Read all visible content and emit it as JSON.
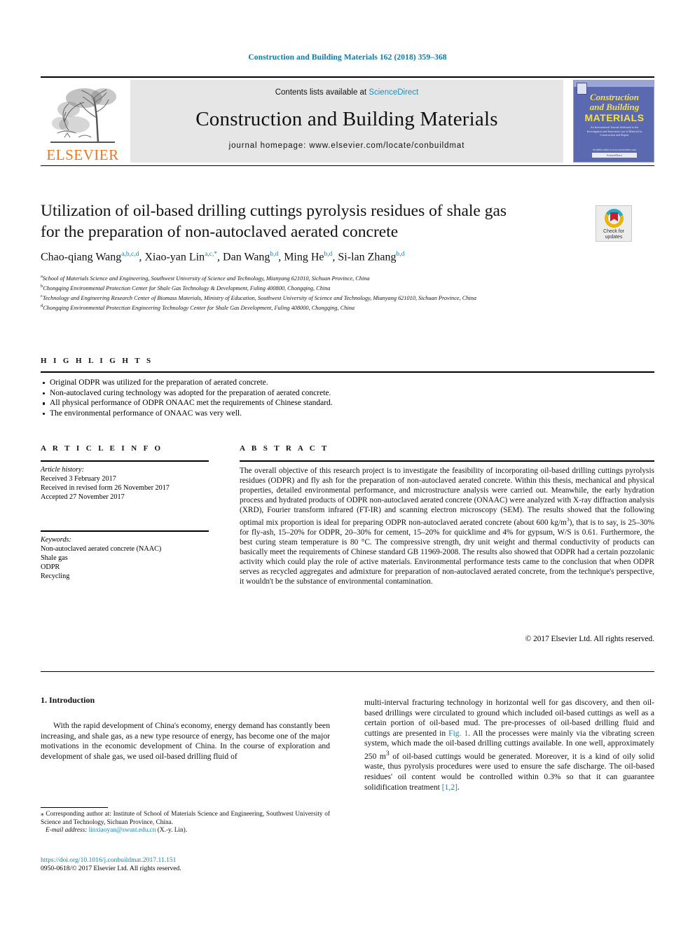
{
  "running_head": "Construction and Building Materials 162 (2018) 359–368",
  "masthead": {
    "publisher_name": "ELSEVIER",
    "contents_prefix": "Contents lists available at ",
    "contents_link": "ScienceDirect",
    "journal_title": "Construction and Building Materials",
    "homepage_label": "journal homepage: www.elsevier.com/locate/conbuildmat",
    "cover": {
      "line1": "Construction",
      "line2": "and Building",
      "line3": "MATERIALS",
      "blurb": "An International Journal dedicated to the Investigation and Innovative use of Material in Construction and Repair",
      "footer": "Available online at www.sciencedirect.com",
      "footer_box": "ScienceDirect"
    }
  },
  "article": {
    "title_line1": "Utilization of oil-based drilling cuttings pyrolysis residues of shale gas",
    "title_line2": "for the preparation of non-autoclaved aerated concrete",
    "crossmark": {
      "line1": "Check for",
      "line2": "updates"
    },
    "authors": [
      {
        "name": "Chao-qiang Wang",
        "sup": "a,b,c,d"
      },
      {
        "name": "Xiao-yan Lin",
        "sup": "a,c,*"
      },
      {
        "name": "Dan Wang",
        "sup": "b,d"
      },
      {
        "name": "Ming He",
        "sup": "b,d"
      },
      {
        "name": "Si-lan Zhang",
        "sup": "b,d"
      }
    ],
    "affiliations": [
      {
        "marker": "a",
        "text": "School of Materials Science and Engineering, Southwest University of Science and Technology, Mianyang 621010, Sichuan Province, China"
      },
      {
        "marker": "b",
        "text": "Chongqing Environmental Protection Center for Shale Gas Technology & Development, Fuling 400800, Chongqing, China"
      },
      {
        "marker": "c",
        "text": "Technology and Engineering Research Center of Biomass Materials, Ministry of Education, Southwest University of Science and Technology, Mianyang 621010, Sichuan Province, China"
      },
      {
        "marker": "d",
        "text": "Chongqing Environmental Protection Engineering Technology Center for Shale Gas Development, Fuling 408000, Chongqing, China"
      }
    ]
  },
  "highlights": {
    "label": "H I G H L I G H T S",
    "items": [
      "Original ODPR was utilized for the preparation of aerated concrete.",
      "Non-autoclaved curing technology was adopted for the preparation of aerated concrete.",
      "All physical performance of ODPR ONAAC met the requirements of Chinese standard.",
      "The environmental performance of ONAAC was very well."
    ]
  },
  "article_info": {
    "label": "A R T I C L E   I N F O",
    "history_label": "Article history:",
    "history": [
      "Received 3 February 2017",
      "Received in revised form 26 November 2017",
      "Accepted 27 November 2017"
    ],
    "keywords_label": "Keywords:",
    "keywords": [
      "Non-autoclaved aerated concrete (NAAC)",
      "Shale gas",
      "ODPR",
      "Recycling"
    ]
  },
  "abstract": {
    "label": "A B S T R A C T",
    "text_part1": "The overall objective of this research project is to investigate the feasibility of incorporating oil-based drilling cuttings pyrolysis residues (ODPR) and fly ash for the preparation of non-autoclaved aerated concrete. Within this thesis, mechanical and physical properties, detailed environmental performance, and microstructure analysis were carried out. Meanwhile, the early hydration process and hydrated products of ODPR non-autoclaved aerated concrete (ONAAC) were analyzed with X-ray diffraction analysis (XRD), Fourier transform infrared (FT-IR) and scanning electron microscopy (SEM). The results showed that the following optimal mix proportion is ideal for preparing ODPR non-autoclaved aerated concrete (about 600 kg/m",
    "sup1": "3",
    "text_part2": "), that is to say, is 25–30% for fly-ash, 15–20% for ODPR, 20–30% for cement, 15–20% for quicklime and 4% for gypsum, W/S is 0.61. Furthermore, the best curing steam temperature is 80 °C. The compressive strength, dry unit weight and thermal conductivity of products can basically meet the requirements of Chinese standard GB 11969-2008. The results also showed that ODPR had a certain pozzolanic activity which could play the role of active materials. Environmental performance tests came to the conclusion that when ODPR serves as recycled aggregates and admixture for preparation of non-autoclaved aerated concrete, from the technique's perspective, it wouldn't be the substance of environmental contamination.",
    "copyright": "© 2017 Elsevier Ltd. All rights reserved."
  },
  "body": {
    "section_heading": "1. Introduction",
    "left_paragraph": "With the rapid development of China's economy, energy demand has constantly been increasing, and shale gas, as a new type resource of energy, has become one of the major motivations in the economic development of China. In the course of exploration and development of shale gas, we used oil-based drilling fluid of",
    "right_part1": "multi-interval fracturing technology in horizontal well for gas discovery, and then oil-based drillings were circulated to ground which included oil-based cuttings as well as a certain portion of oil-based mud. The pre-processes of oil-based drilling fluid and cuttings are presented in ",
    "right_fig_link": "Fig. 1",
    "right_part2": ". All the processes were mainly via the vibrating screen system, which made the oil-based drilling cuttings available. In one well, approximately 250 m",
    "right_sup": "3",
    "right_part3": " of oil-based cuttings would be generated. Moreover, it is a kind of oily solid waste, thus pyrolysis procedures were used to ensure the safe discharge. The oil-based residues' oil content would be controlled within 0.3% so that it can guarantee solidification treatment ",
    "right_ref_link": "[1,2]",
    "right_part4": "."
  },
  "footnotes": {
    "corresponding_marker": "⁎",
    "corresponding_text": " Corresponding author at: Institute of School of Materials Science and Engineering, Southwest University of Science and Technology, Sichuan Province, China.",
    "email_label": "E-mail address:",
    "email": "linxiaoyan@swust.edu.cn",
    "email_owner": " (X.-y. Lin).",
    "doi": "https://doi.org/10.1016/j.conbuildmat.2017.11.151",
    "issn_line": "0950-0618/© 2017 Elsevier Ltd. All rights reserved."
  },
  "colors": {
    "link_blue": "#1a7fb0",
    "elsevier_orange": "#e87722",
    "cover_blue": "#5b6ab0",
    "cover_yellow": "#f3e04a",
    "panel_grey": "#e6e6e6"
  }
}
